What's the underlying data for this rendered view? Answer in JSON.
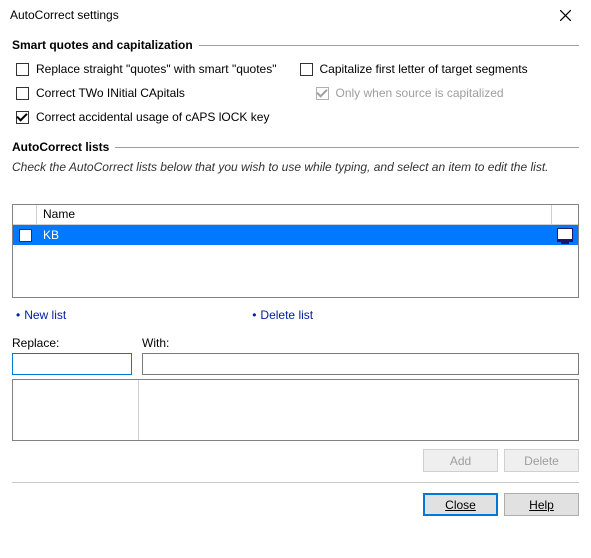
{
  "title": "AutoCorrect settings",
  "group1": {
    "label": "Smart quotes and capitalization",
    "replace_quotes": "Replace straight \"quotes\" with smart \"quotes\"",
    "capitalize_first": "Capitalize first letter of target segments",
    "two_initial": "Correct TWo INitial CApitals",
    "only_source": "Only when source is capitalized",
    "caps_lock": "Correct accidental usage of cAPS lOCK key"
  },
  "group2": {
    "label": "AutoCorrect lists",
    "note": "Check the AutoCorrect lists below that you wish to use while typing, and select an item to edit the list."
  },
  "table": {
    "name_header": "Name",
    "rows": [
      {
        "name": "KB",
        "checked": false,
        "selected": true
      }
    ]
  },
  "links": {
    "new_list": "New list",
    "delete_list": "Delete list"
  },
  "replace": {
    "replace_label": "Replace:",
    "with_label": "With:",
    "replace_value": "",
    "with_value": ""
  },
  "buttons": {
    "add": "Add",
    "delete": "Delete",
    "close": "Close",
    "help": "Help"
  }
}
